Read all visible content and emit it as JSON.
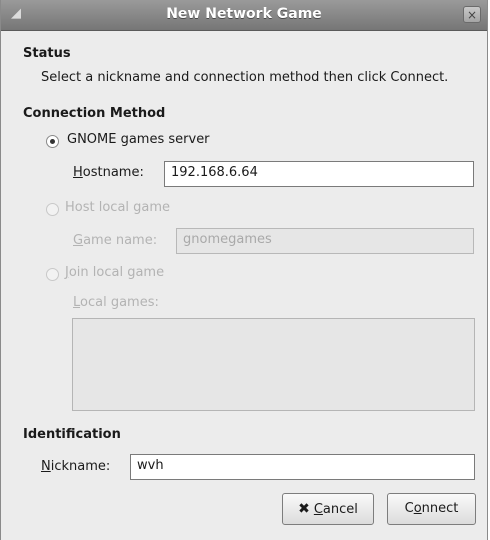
{
  "window": {
    "title": "New Network Game",
    "close_glyph": "×"
  },
  "status": {
    "heading": "Status",
    "message": "Select a nickname and connection method then click Connect."
  },
  "connection": {
    "heading": "Connection Method",
    "gnome_server": {
      "label": "GNOME games server",
      "selected": true
    },
    "hostname": {
      "mnemonic": "H",
      "rest": "ostname:",
      "value": "192.168.6.64"
    },
    "host_local": {
      "label": "Host local game",
      "enabled": false
    },
    "game_name": {
      "mnemonic": "G",
      "rest": "ame name:",
      "value": "gnomegames"
    },
    "join_local": {
      "mnemonic": "J",
      "rest": "oin local game",
      "enabled": false
    },
    "local_games": {
      "mnemonic": "L",
      "rest": "ocal games:"
    }
  },
  "identification": {
    "heading": "Identification",
    "nickname": {
      "mnemonic": "N",
      "rest": "ickname:",
      "value": "wvh"
    }
  },
  "buttons": {
    "cancel": {
      "mnemonic": "C",
      "rest": "ancel",
      "icon": "cancel-x-icon"
    },
    "connect": {
      "pre": "C",
      "mnemonic": "o",
      "rest": "nnect"
    }
  }
}
